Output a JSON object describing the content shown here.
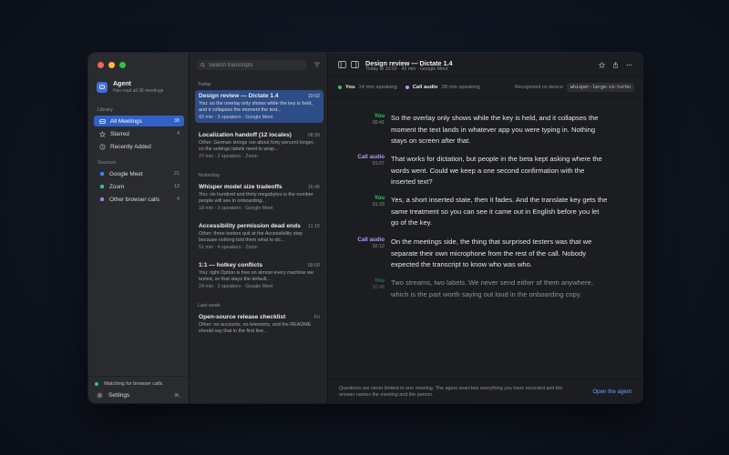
{
  "sidebar": {
    "app_name": "Agent",
    "app_subtitle": "Has read all 38 meetings",
    "library_label": "Library",
    "library": [
      {
        "label": "All Meetings",
        "count": "38"
      },
      {
        "label": "Starred",
        "count": "4"
      },
      {
        "label": "Recently Added",
        "count": ""
      }
    ],
    "sources_label": "Sources",
    "sources": [
      {
        "label": "Google Meet",
        "count": "21",
        "color": "#3b82f6"
      },
      {
        "label": "Zoom",
        "count": "13",
        "color": "#22c3a6"
      },
      {
        "label": "Other browser calls",
        "count": "4",
        "color": "#9b7bea"
      }
    ],
    "watching": "Watching for browser calls",
    "settings_label": "Settings",
    "settings_shortcut": "⌘,"
  },
  "list": {
    "search_placeholder": "Search transcripts",
    "groups": [
      {
        "label": "Today"
      },
      {
        "label": "Yesterday"
      },
      {
        "label": "Last week"
      }
    ],
    "items": [
      {
        "title": "Design review — Dictate 1.4",
        "time": "10:02",
        "excerpt": "You: so the overlay only shows while the key is held, and it collapses the moment the text...",
        "meta": "42 min · 3 speakers · Google Meet"
      },
      {
        "title": "Localization handoff (12 locales)",
        "time": "08:30",
        "excerpt": "Other: German strings run about forty percent longer, so the settings labels need to wrap...",
        "meta": "27 min · 2 speakers · Zoom"
      },
      {
        "title": "Whisper model size tradeoffs",
        "time": "16:45",
        "excerpt": "You: six hundred and thirty megabytes is the number people will see in onboarding...",
        "meta": "18 min · 3 speakers · Google Meet"
      },
      {
        "title": "Accessibility permission dead ends",
        "time": "11:15",
        "excerpt": "Other: three testers quit at the Accessibility step because nothing told them what to do...",
        "meta": "51 min · 4 speakers · Zoom"
      },
      {
        "title": "1:1 — hotkey conflicts",
        "time": "09:00",
        "excerpt": "You: right Option is free on almost every machine we tested, so that stays the default...",
        "meta": "24 min · 2 speakers · Google Meet"
      },
      {
        "title": "Open-source release checklist",
        "time": "Fri",
        "excerpt": "Other: no accounts, no telemetry, and the README should say that in the first line...",
        "meta": ""
      }
    ]
  },
  "doc": {
    "title": "Design review — Dictate 1.4",
    "subtitle": "Today at 10:02 · 42 min · Google Meet"
  },
  "speakers": {
    "you_label": "You",
    "you_time": "14 min speaking",
    "you_color": "#35c46a",
    "call_label": "Call audio",
    "call_time": "28 min speaking",
    "call_color": "#b39df2",
    "recognized": "Recognized on device",
    "model": "whisper-large-v3-turbo"
  },
  "transcript": [
    {
      "who": "You",
      "ts": "00:41",
      "text": "So the overlay only shows while the key is held, and it collapses the moment the text lands in whatever app you were typing in. Nothing stays on screen after that."
    },
    {
      "who": "Call audio",
      "ts": "01:07",
      "text": "That works for dictation, but people in the beta kept asking where the words went. Could we keep a one second confirmation with the inserted text?"
    },
    {
      "who": "You",
      "ts": "01:29",
      "text": "Yes, a short inserted state, then it fades. And the translate key gets the same treatment so you can see it came out in English before you let go of the key."
    },
    {
      "who": "Call audio",
      "ts": "02:12",
      "text": "On the meetings side, the thing that surprised testers was that we separate their own microphone from the rest of the call. Nobody expected the transcript to know who was who."
    },
    {
      "who": "You",
      "ts": "02:48",
      "text": "Two streams, two labels. We never send either of them anywhere, which is the part worth saying out loud in the onboarding copy."
    }
  ],
  "footer": {
    "note": "Questions are never limited to one meeting. The agent searches everything you have recorded and the answer names the meeting and the person.",
    "open_agent": "Open the agent"
  },
  "colors": {
    "accent": "#3161c6",
    "link": "#6ea0ff",
    "you": "#35c46a",
    "call": "#b39df2"
  }
}
